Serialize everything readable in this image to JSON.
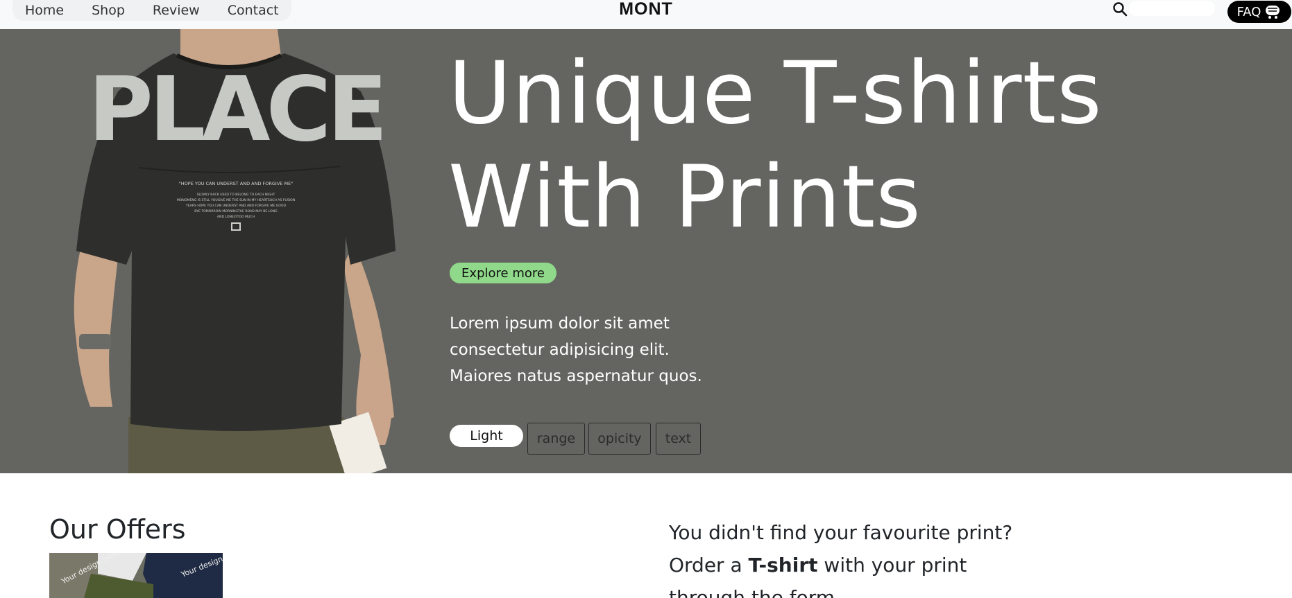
{
  "navbar": {
    "links": [
      "Home",
      "Shop",
      "Review",
      "Contact"
    ],
    "brand": "MONT",
    "search": {
      "icon": "search-icon",
      "placeholder": ""
    },
    "faq_label": "FAQ",
    "cart_icon": "cart-icon"
  },
  "hero": {
    "title_line1": "Unique T-shirts",
    "title_line2": "With Prints",
    "explore_label": "Explore more",
    "description_lines": [
      "Lorem ipsum dolor sit amet",
      "consectetur adipisicing elit.",
      "Maiores natus aspernatur quos."
    ],
    "chips": [
      "Light",
      "range",
      "opicity",
      "text"
    ],
    "tshirt_print": {
      "back_word": "PLACE",
      "tagline": "\"HOPE YOU CAN UNDERST AND AND FORGIVE ME\"",
      "body_lines": [
        "SLOWLY BACK USED TO BELONG TO EACH NIGHT",
        "MONOMENG IS STILL YOUGIVE ME THE SUN IN MY HEARTSUCH AS FUSION",
        "YEARS HOPE YOU CAN UNDERST AND AND FORGIVE ME GOOD",
        "BYE TOMORROW MORNINGTHE ROAD MAY BE LONG",
        "AND LONELYTOO MUCH"
      ]
    },
    "colors": {
      "background": "#646560",
      "explore_button": "#90d98a"
    }
  },
  "offers": {
    "title": "Our Offers",
    "thumb_text": "Your design here"
  },
  "promo": {
    "line1": "You didn't find your favourite print?",
    "line2_before": "Order a ",
    "line2_bold": "T-shirt",
    "line2_after": " with your print",
    "line3": "through the form"
  }
}
